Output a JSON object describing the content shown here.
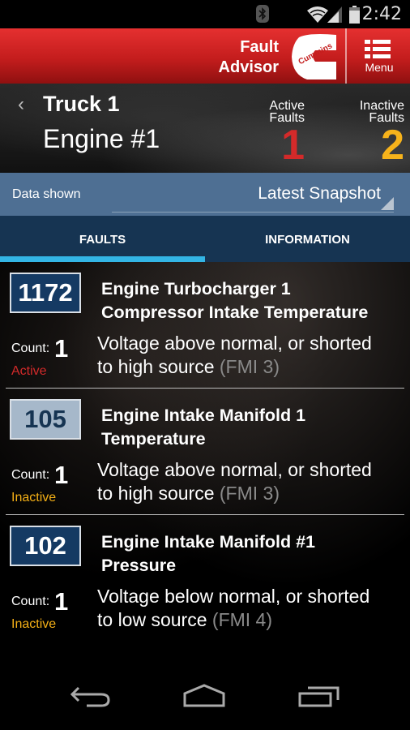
{
  "status_bar": {
    "time": "2:42",
    "icons": [
      "bluetooth-icon",
      "wifi-icon",
      "signal-icon",
      "battery-icon"
    ]
  },
  "app_bar": {
    "title_line1": "Fault",
    "title_line2": "Advisor",
    "logo_text": "Cummins",
    "menu_label": "Menu",
    "brand_color": "#d42a2a"
  },
  "header": {
    "back_glyph": "‹",
    "truck_name": "Truck 1",
    "engine_name": "Engine #1",
    "active_faults_label_1": "Active",
    "active_faults_label_2": "Faults",
    "active_faults_count": "1",
    "inactive_faults_label_1": "Inactive",
    "inactive_faults_label_2": "Faults",
    "inactive_faults_count": "2",
    "active_color": "#d32a2a",
    "inactive_color": "#f7b31b"
  },
  "data_shown": {
    "label": "Data shown",
    "selected": "Latest Snapshot"
  },
  "tabs": [
    {
      "label": "FAULTS",
      "selected": true
    },
    {
      "label": "INFORMATION",
      "selected": false
    }
  ],
  "faults": [
    {
      "code": "1172",
      "title_line1": "Engine Turbocharger 1",
      "title_line2": "Compressor Intake Temperature",
      "count_label": "Count:",
      "count": "1",
      "status": "Active",
      "desc_line1": "Voltage above normal, or shorted",
      "desc_line2": "to high source",
      "fmi": "(FMI 3)"
    },
    {
      "code": "105",
      "title_line1": "Engine Intake Manifold 1",
      "title_line2": "Temperature",
      "count_label": "Count:",
      "count": "1",
      "status": "Inactive",
      "desc_line1": "Voltage above normal, or shorted",
      "desc_line2": "to high source",
      "fmi": "(FMI 3)"
    },
    {
      "code": "102",
      "title_line1": "Engine Intake Manifold #1",
      "title_line2": "Pressure",
      "count_label": "Count:",
      "count": "1",
      "status": "Inactive",
      "desc_line1": "Voltage below normal, or shorted",
      "desc_line2": "to low source",
      "fmi": "(FMI 4)"
    }
  ],
  "nav_bar": {
    "buttons": [
      "back",
      "home",
      "recents"
    ]
  }
}
